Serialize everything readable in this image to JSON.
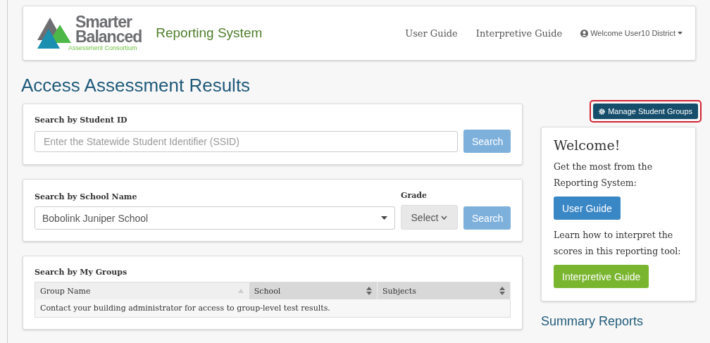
{
  "header": {
    "logo": {
      "line1": "Smarter",
      "line2": "Balanced",
      "tagline": "Assessment Consortium"
    },
    "app_title": "Reporting System",
    "nav": [
      "User Guide",
      "Interpretive Guide"
    ],
    "user_menu": {
      "label": "Welcome User10 District"
    }
  },
  "page_title": "Access Assessment Results",
  "student_search": {
    "label": "Search by Student ID",
    "placeholder": "Enter the Statewide Student Identifier (SSID)",
    "button": "Search"
  },
  "school_search": {
    "label": "Search by School Name",
    "value": "Bobolink Juniper School",
    "grade_label": "Grade",
    "grade_value": "Select",
    "button": "Search"
  },
  "groups": {
    "label": "Search by My Groups",
    "columns": [
      {
        "label": "Group Name",
        "sorted": true
      },
      {
        "label": "School",
        "sorted": false
      },
      {
        "label": "Subjects",
        "sorted": false
      }
    ],
    "empty_message": "Contact your building administrator for access to group-level test results."
  },
  "manage_button": {
    "label": "Manage Student Groups",
    "highlighted": true
  },
  "welcome": {
    "title": "Welcome!",
    "text1": "Get the most from the Reporting System:",
    "button1": "User Guide",
    "text2": "Learn how to interpret the scores in this reporting tool:",
    "button2": "Interpretive Guide"
  },
  "summary_title": "Summary Reports"
}
